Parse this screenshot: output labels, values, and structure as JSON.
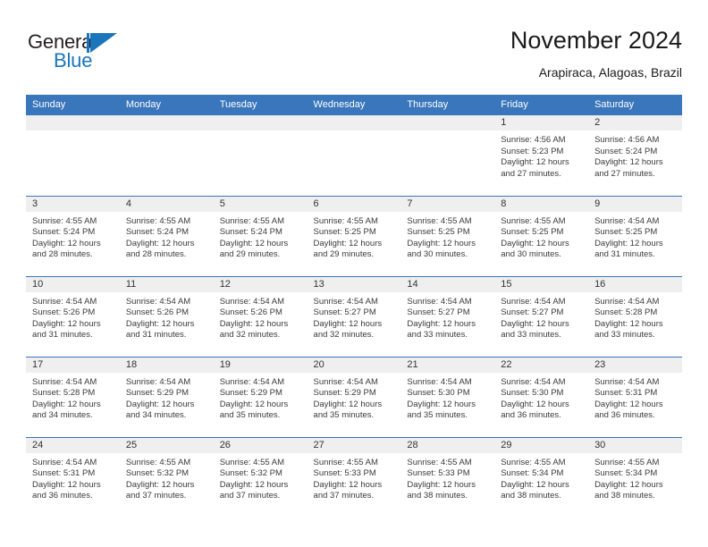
{
  "brand": {
    "name_top": "General",
    "name_bottom": "Blue",
    "color_dark": "#231f20",
    "color_blue": "#1b75bb"
  },
  "header": {
    "title": "November 2024",
    "subtitle": "Arapiraca, Alagoas, Brazil"
  },
  "theme": {
    "header_blue": "#3a76bc",
    "daynum_band": "#efefef",
    "text": "#3b3b3b"
  },
  "weekday_headers": [
    "Sunday",
    "Monday",
    "Tuesday",
    "Wednesday",
    "Thursday",
    "Friday",
    "Saturday"
  ],
  "labels": {
    "sunrise": "Sunrise:",
    "sunset": "Sunset:",
    "daylight": "Daylight:"
  },
  "weeks": [
    [
      {
        "day": "",
        "empty": true
      },
      {
        "day": "",
        "empty": true
      },
      {
        "day": "",
        "empty": true
      },
      {
        "day": "",
        "empty": true
      },
      {
        "day": "",
        "empty": true
      },
      {
        "day": "1",
        "sunrise": "Sunrise: 4:56 AM",
        "sunset": "Sunset: 5:23 PM",
        "daylight": "Daylight: 12 hours and 27 minutes."
      },
      {
        "day": "2",
        "sunrise": "Sunrise: 4:56 AM",
        "sunset": "Sunset: 5:24 PM",
        "daylight": "Daylight: 12 hours and 27 minutes."
      }
    ],
    [
      {
        "day": "3",
        "sunrise": "Sunrise: 4:55 AM",
        "sunset": "Sunset: 5:24 PM",
        "daylight": "Daylight: 12 hours and 28 minutes."
      },
      {
        "day": "4",
        "sunrise": "Sunrise: 4:55 AM",
        "sunset": "Sunset: 5:24 PM",
        "daylight": "Daylight: 12 hours and 28 minutes."
      },
      {
        "day": "5",
        "sunrise": "Sunrise: 4:55 AM",
        "sunset": "Sunset: 5:24 PM",
        "daylight": "Daylight: 12 hours and 29 minutes."
      },
      {
        "day": "6",
        "sunrise": "Sunrise: 4:55 AM",
        "sunset": "Sunset: 5:25 PM",
        "daylight": "Daylight: 12 hours and 29 minutes."
      },
      {
        "day": "7",
        "sunrise": "Sunrise: 4:55 AM",
        "sunset": "Sunset: 5:25 PM",
        "daylight": "Daylight: 12 hours and 30 minutes."
      },
      {
        "day": "8",
        "sunrise": "Sunrise: 4:55 AM",
        "sunset": "Sunset: 5:25 PM",
        "daylight": "Daylight: 12 hours and 30 minutes."
      },
      {
        "day": "9",
        "sunrise": "Sunrise: 4:54 AM",
        "sunset": "Sunset: 5:25 PM",
        "daylight": "Daylight: 12 hours and 31 minutes."
      }
    ],
    [
      {
        "day": "10",
        "sunrise": "Sunrise: 4:54 AM",
        "sunset": "Sunset: 5:26 PM",
        "daylight": "Daylight: 12 hours and 31 minutes."
      },
      {
        "day": "11",
        "sunrise": "Sunrise: 4:54 AM",
        "sunset": "Sunset: 5:26 PM",
        "daylight": "Daylight: 12 hours and 31 minutes."
      },
      {
        "day": "12",
        "sunrise": "Sunrise: 4:54 AM",
        "sunset": "Sunset: 5:26 PM",
        "daylight": "Daylight: 12 hours and 32 minutes."
      },
      {
        "day": "13",
        "sunrise": "Sunrise: 4:54 AM",
        "sunset": "Sunset: 5:27 PM",
        "daylight": "Daylight: 12 hours and 32 minutes."
      },
      {
        "day": "14",
        "sunrise": "Sunrise: 4:54 AM",
        "sunset": "Sunset: 5:27 PM",
        "daylight": "Daylight: 12 hours and 33 minutes."
      },
      {
        "day": "15",
        "sunrise": "Sunrise: 4:54 AM",
        "sunset": "Sunset: 5:27 PM",
        "daylight": "Daylight: 12 hours and 33 minutes."
      },
      {
        "day": "16",
        "sunrise": "Sunrise: 4:54 AM",
        "sunset": "Sunset: 5:28 PM",
        "daylight": "Daylight: 12 hours and 33 minutes."
      }
    ],
    [
      {
        "day": "17",
        "sunrise": "Sunrise: 4:54 AM",
        "sunset": "Sunset: 5:28 PM",
        "daylight": "Daylight: 12 hours and 34 minutes."
      },
      {
        "day": "18",
        "sunrise": "Sunrise: 4:54 AM",
        "sunset": "Sunset: 5:29 PM",
        "daylight": "Daylight: 12 hours and 34 minutes."
      },
      {
        "day": "19",
        "sunrise": "Sunrise: 4:54 AM",
        "sunset": "Sunset: 5:29 PM",
        "daylight": "Daylight: 12 hours and 35 minutes."
      },
      {
        "day": "20",
        "sunrise": "Sunrise: 4:54 AM",
        "sunset": "Sunset: 5:29 PM",
        "daylight": "Daylight: 12 hours and 35 minutes."
      },
      {
        "day": "21",
        "sunrise": "Sunrise: 4:54 AM",
        "sunset": "Sunset: 5:30 PM",
        "daylight": "Daylight: 12 hours and 35 minutes."
      },
      {
        "day": "22",
        "sunrise": "Sunrise: 4:54 AM",
        "sunset": "Sunset: 5:30 PM",
        "daylight": "Daylight: 12 hours and 36 minutes."
      },
      {
        "day": "23",
        "sunrise": "Sunrise: 4:54 AM",
        "sunset": "Sunset: 5:31 PM",
        "daylight": "Daylight: 12 hours and 36 minutes."
      }
    ],
    [
      {
        "day": "24",
        "sunrise": "Sunrise: 4:54 AM",
        "sunset": "Sunset: 5:31 PM",
        "daylight": "Daylight: 12 hours and 36 minutes."
      },
      {
        "day": "25",
        "sunrise": "Sunrise: 4:55 AM",
        "sunset": "Sunset: 5:32 PM",
        "daylight": "Daylight: 12 hours and 37 minutes."
      },
      {
        "day": "26",
        "sunrise": "Sunrise: 4:55 AM",
        "sunset": "Sunset: 5:32 PM",
        "daylight": "Daylight: 12 hours and 37 minutes."
      },
      {
        "day": "27",
        "sunrise": "Sunrise: 4:55 AM",
        "sunset": "Sunset: 5:33 PM",
        "daylight": "Daylight: 12 hours and 37 minutes."
      },
      {
        "day": "28",
        "sunrise": "Sunrise: 4:55 AM",
        "sunset": "Sunset: 5:33 PM",
        "daylight": "Daylight: 12 hours and 38 minutes."
      },
      {
        "day": "29",
        "sunrise": "Sunrise: 4:55 AM",
        "sunset": "Sunset: 5:34 PM",
        "daylight": "Daylight: 12 hours and 38 minutes."
      },
      {
        "day": "30",
        "sunrise": "Sunrise: 4:55 AM",
        "sunset": "Sunset: 5:34 PM",
        "daylight": "Daylight: 12 hours and 38 minutes."
      }
    ]
  ]
}
